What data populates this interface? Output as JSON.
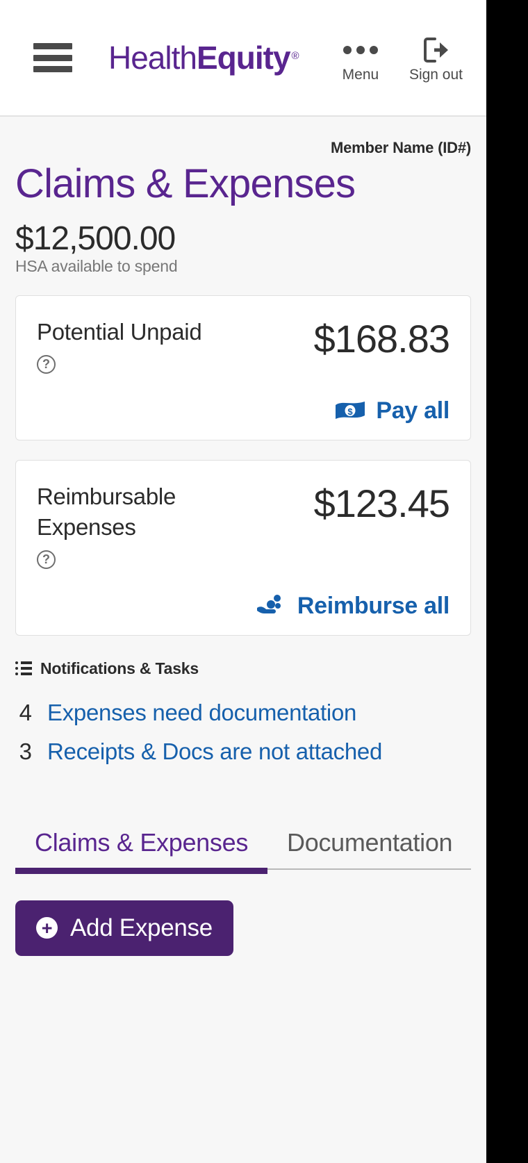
{
  "header": {
    "menu_icon": "hamburger-icon",
    "brand_first": "Health",
    "brand_second": "Equity",
    "brand_trademark": "®",
    "actions": [
      {
        "icon": "ellipsis-icon",
        "label": "Menu"
      },
      {
        "icon": "sign-out-icon",
        "label": "Sign out"
      }
    ]
  },
  "page": {
    "member": "Member Name (ID#)",
    "title": "Claims & Expenses",
    "balance_amount": "$12,500.00",
    "balance_caption": "HSA available to spend"
  },
  "cards": [
    {
      "label": "Potential Unpaid",
      "amount": "$168.83",
      "help_glyph": "?",
      "help_icon": "help-circle-icon",
      "action_label": "Pay all",
      "action_icon": "banknote-icon"
    },
    {
      "label": "Reimbursable Expenses",
      "amount": "$123.45",
      "help_glyph": "?",
      "help_icon": "help-circle-icon",
      "action_label": "Reimburse all",
      "action_icon": "hand-coins-icon"
    }
  ],
  "notifications": {
    "heading": "Notifications & Tasks",
    "heading_icon": "list-icon",
    "items": [
      {
        "count": "4",
        "label": "Expenses need documentation"
      },
      {
        "count": "3",
        "label": "Receipts & Docs are not attached"
      }
    ]
  },
  "tabs": [
    {
      "label": "Claims & Expenses",
      "active": true
    },
    {
      "label": "Documentation",
      "active": false
    }
  ],
  "add_expense": {
    "label": "Add Expense",
    "icon": "plus-circle-icon",
    "plus_glyph": "+"
  },
  "colors": {
    "brand_purple": "#59258f",
    "tab_purple": "#4b2270",
    "link_blue": "#1660ac",
    "page_bg": "#f7f7f7",
    "card_bg": "#ffffff"
  }
}
